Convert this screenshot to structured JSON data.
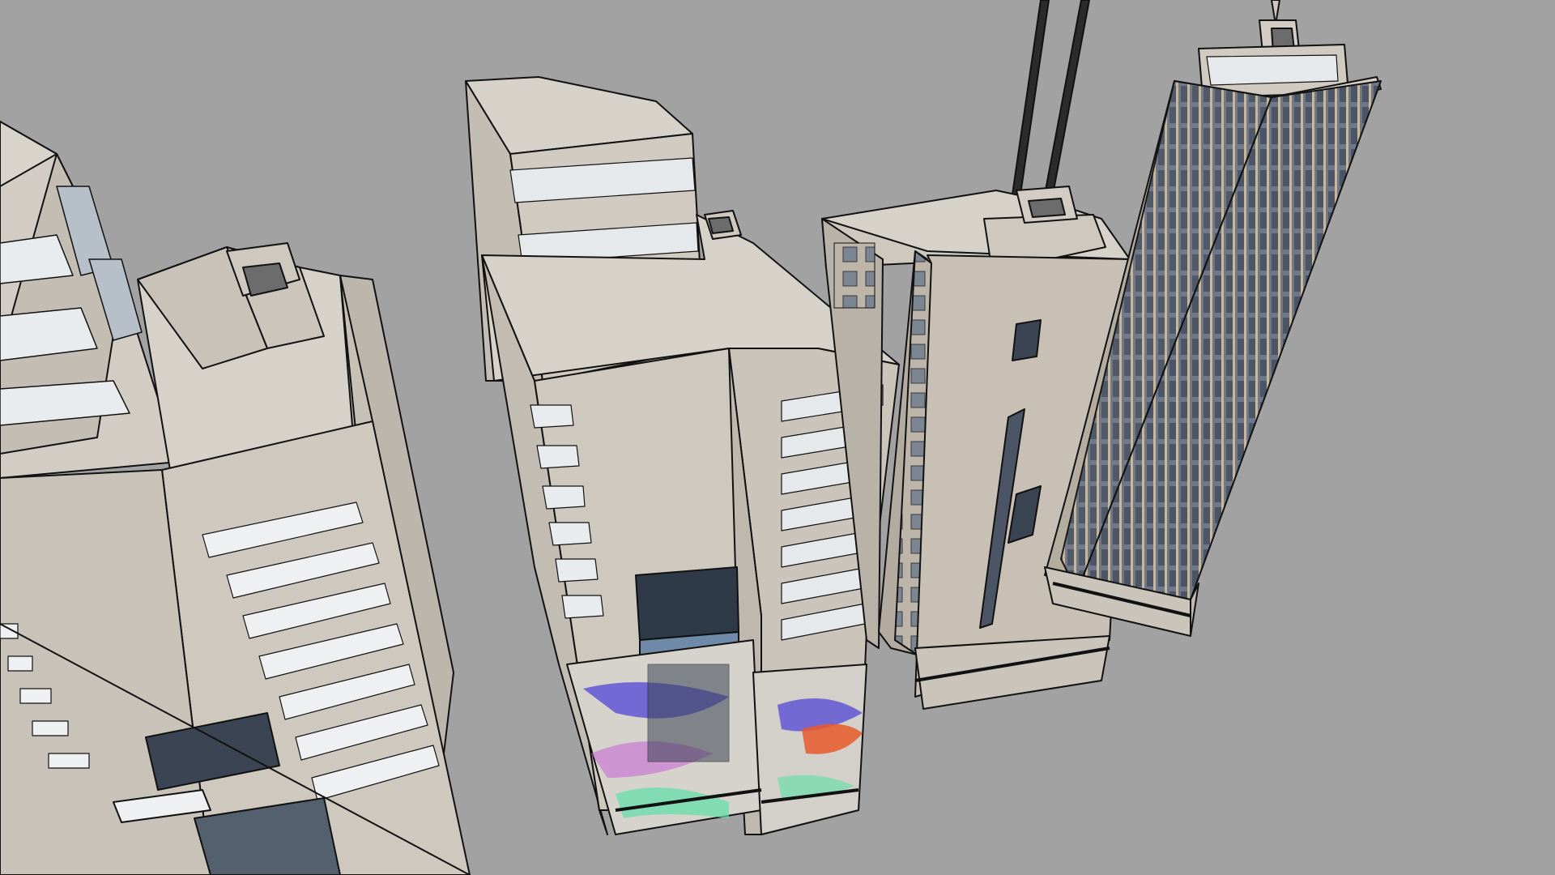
{
  "viewport": {
    "background": "#a2a2a2",
    "edge_color": "#111111",
    "facade_color": "#cfc9c0",
    "facade_shade": "#b9b2a8",
    "roof_color": "#d6d1c9",
    "window_color": "#8e9aa6",
    "window_light": "#e9ecef",
    "glass_dark": "#2f3a48",
    "tower_glass": "#6b7484",
    "graffiti_colors": [
      "#5a4fd6",
      "#e85a2a",
      "#5ee0a8",
      "#c66bd6"
    ]
  },
  "scene": {
    "models": [
      {
        "name": "building-left",
        "icon": "building-icon"
      },
      {
        "name": "building-center",
        "icon": "building-icon"
      },
      {
        "name": "building-antenna",
        "icon": "building-icon"
      },
      {
        "name": "building-tall-right",
        "icon": "building-icon"
      }
    ]
  }
}
